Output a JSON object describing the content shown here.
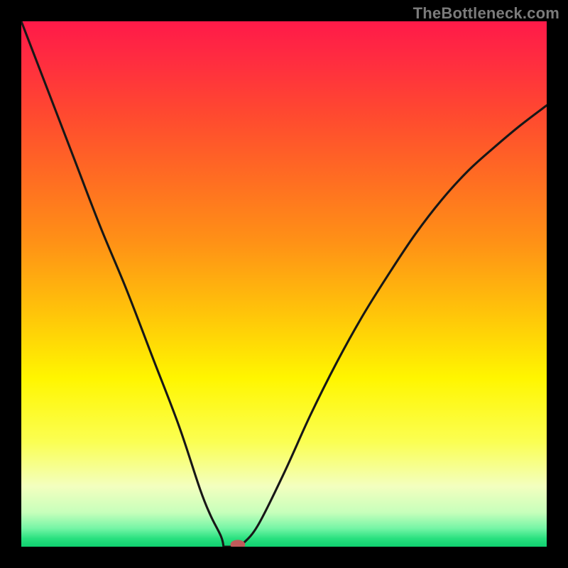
{
  "watermark": "TheBottleneck.com",
  "chart_data": {
    "type": "line",
    "title": "",
    "xlabel": "",
    "ylabel": "",
    "xlim": [
      0,
      100
    ],
    "ylim": [
      0,
      100
    ],
    "series": [
      {
        "name": "curve",
        "x": [
          0,
          5,
          10,
          15,
          20,
          25,
          30,
          34,
          36,
          38,
          39,
          40,
          41,
          42,
          45,
          50,
          55,
          60,
          65,
          70,
          75,
          80,
          85,
          90,
          95,
          100
        ],
        "values": [
          100,
          87,
          74,
          61,
          49,
          36,
          23,
          11,
          6,
          2,
          0.6,
          0,
          0,
          0.4,
          4,
          14,
          25,
          35,
          44,
          52,
          59.5,
          66,
          71.5,
          76,
          80.2,
          84
        ]
      }
    ],
    "flat_segment": {
      "x_start": 38.5,
      "x_end": 41.5,
      "y": 0
    },
    "marker": {
      "x": 41.2,
      "y": 0.4,
      "color": "#c15a5a",
      "rx": 1.4,
      "ry": 0.9
    },
    "background_gradient": {
      "stops": [
        {
          "offset": 0.0,
          "color": "#ff1a49"
        },
        {
          "offset": 0.08,
          "color": "#ff2e3f"
        },
        {
          "offset": 0.18,
          "color": "#ff4a2f"
        },
        {
          "offset": 0.3,
          "color": "#ff6d22"
        },
        {
          "offset": 0.42,
          "color": "#ff9116"
        },
        {
          "offset": 0.55,
          "color": "#ffc20a"
        },
        {
          "offset": 0.68,
          "color": "#fff600"
        },
        {
          "offset": 0.8,
          "color": "#fbff52"
        },
        {
          "offset": 0.885,
          "color": "#f3ffbf"
        },
        {
          "offset": 0.935,
          "color": "#c7ffbb"
        },
        {
          "offset": 0.965,
          "color": "#75f5a6"
        },
        {
          "offset": 0.985,
          "color": "#27e07e"
        },
        {
          "offset": 1.0,
          "color": "#10d070"
        }
      ]
    },
    "curve_stroke": "#171717",
    "curve_width": 3.1
  }
}
